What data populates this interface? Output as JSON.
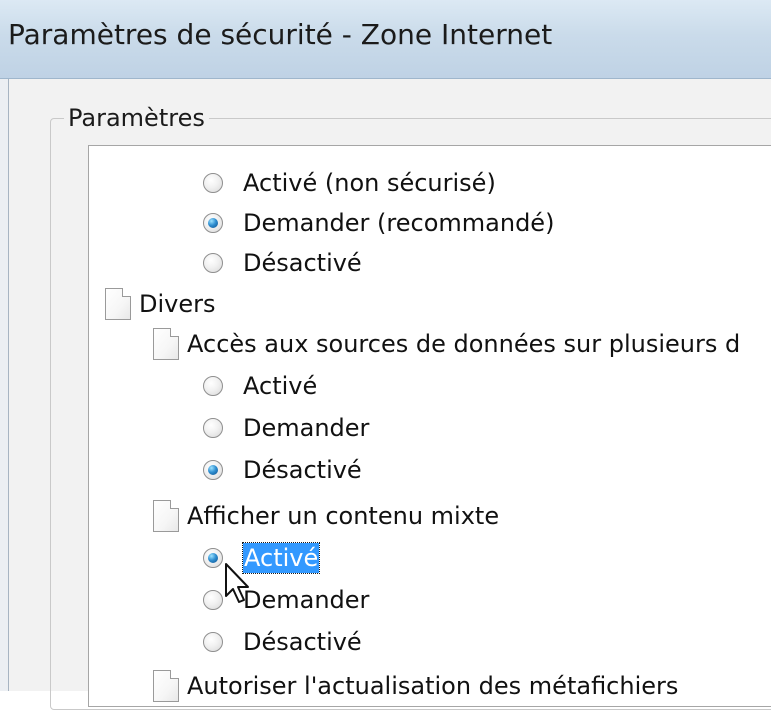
{
  "window": {
    "title": "Paramètres de sécurité - Zone Internet"
  },
  "group": {
    "label": "Paramètres"
  },
  "tree": {
    "top_options": [
      {
        "label": "Activé (non sécurisé)",
        "checked": false
      },
      {
        "label": "Demander (recommandé)",
        "checked": true
      },
      {
        "label": "Désactivé",
        "checked": false
      }
    ],
    "section": {
      "label": "Divers"
    },
    "settings": [
      {
        "label": "Accès aux sources de données sur plusieurs d",
        "options": [
          {
            "label": "Activé",
            "checked": false
          },
          {
            "label": "Demander",
            "checked": false
          },
          {
            "label": "Désactivé",
            "checked": true
          }
        ]
      },
      {
        "label": "Afficher un contenu mixte",
        "options": [
          {
            "label": "Activé",
            "checked": true,
            "selected": true
          },
          {
            "label": "Demander",
            "checked": false
          },
          {
            "label": "Désactivé",
            "checked": false
          }
        ]
      },
      {
        "label": "Autoriser l'actualisation des métafichiers"
      }
    ]
  },
  "cursor": {
    "icon": "arrow-cursor-icon"
  }
}
